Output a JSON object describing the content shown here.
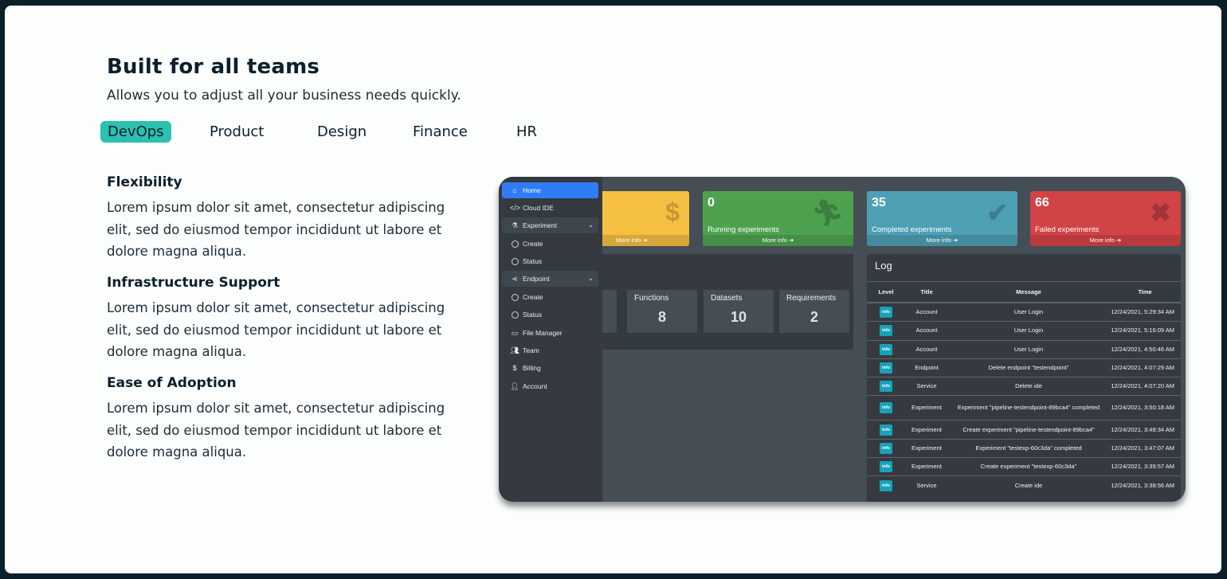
{
  "heading": {
    "title": "Built for all teams",
    "subtitle": "Allows you to adjust all your business needs quickly."
  },
  "tabs": [
    {
      "label": "DevOps",
      "active": true
    },
    {
      "label": "Product",
      "active": false
    },
    {
      "label": "Design",
      "active": false
    },
    {
      "label": "Finance",
      "active": false
    },
    {
      "label": "HR",
      "active": false
    }
  ],
  "features": [
    {
      "title": "Flexibility",
      "body": "Lorem ipsum dolor sit amet, consectetur adipiscing elit, sed do eiusmod tempor incididunt ut labore et dolore magna aliqua."
    },
    {
      "title": "Infrastructure Support",
      "body": "Lorem ipsum dolor sit amet, consectetur adipiscing elit, sed do eiusmod tempor incididunt ut labore et dolore magna aliqua."
    },
    {
      "title": "Ease of Adoption",
      "body": "Lorem ipsum dolor sit amet, consectetur adipiscing elit, sed do eiusmod tempor incididunt ut labore et dolore magna aliqua."
    }
  ],
  "dashboard": {
    "sidebar": [
      {
        "label": "Home",
        "icon": "home-icon",
        "active": true
      },
      {
        "label": "Cloud IDE",
        "icon": "code-icon"
      },
      {
        "label": "Experiment",
        "icon": "flask-icon",
        "group": true
      },
      {
        "label": "Create",
        "icon": "circle-icon"
      },
      {
        "label": "Status",
        "icon": "circle-icon"
      },
      {
        "label": "Endpoint",
        "icon": "share-icon",
        "group": true
      },
      {
        "label": "Create",
        "icon": "circle-icon"
      },
      {
        "label": "Status",
        "icon": "circle-icon"
      },
      {
        "label": "File Manager",
        "icon": "drive-icon"
      },
      {
        "label": "Team",
        "icon": "users-icon"
      },
      {
        "label": "Billing",
        "icon": "dollar-icon"
      },
      {
        "label": "Account",
        "icon": "user-icon"
      }
    ],
    "cards": [
      {
        "value": "",
        "label": "",
        "footer": "More info",
        "color": "#f5bf42",
        "icon": "$"
      },
      {
        "value": "0",
        "label": "Running experiments",
        "footer": "More info",
        "color": "#4ea24f",
        "icon": "running-icon"
      },
      {
        "value": "35",
        "label": "Completed experiments",
        "footer": "More info",
        "color": "#4da0b4",
        "icon": "check-icon"
      },
      {
        "value": "66",
        "label": "Failed experiments",
        "footer": "More info",
        "color": "#d24346",
        "icon": "times-icon"
      }
    ],
    "stats": [
      {
        "label": "Functions",
        "value": "8"
      },
      {
        "label": "Datasets",
        "value": "10"
      },
      {
        "label": "Requirements",
        "value": "2"
      }
    ],
    "log": {
      "title": "Log",
      "columns": [
        "Level",
        "Title",
        "Message",
        "Time"
      ],
      "rows": [
        {
          "level": "info",
          "title": "Account",
          "message": "User Login",
          "time": "12/24/2021, 5:29:34 AM"
        },
        {
          "level": "info",
          "title": "Account",
          "message": "User Login",
          "time": "12/24/2021, 5:16:09 AM"
        },
        {
          "level": "info",
          "title": "Account",
          "message": "User Login",
          "time": "12/24/2021, 4:50:46 AM"
        },
        {
          "level": "info",
          "title": "Endpoint",
          "message": "Delete endpoint \"testendpoint\"",
          "time": "12/24/2021, 4:07:29 AM"
        },
        {
          "level": "info",
          "title": "Service",
          "message": "Delete ide",
          "time": "12/24/2021, 4:07:20 AM"
        },
        {
          "level": "info",
          "title": "Experiment",
          "message": "Experiment \"pipeline-testendpoint-89bca4\" completed",
          "time": "12/24/2021, 3:50:18 AM"
        },
        {
          "level": "info",
          "title": "Experiment",
          "message": "Create experiment \"pipeline-testendpoint-89bca4\"",
          "time": "12/24/2021, 3:48:34 AM"
        },
        {
          "level": "info",
          "title": "Experiment",
          "message": "Experiment \"testexp-60c3da\" completed",
          "time": "12/24/2021, 3:47:07 AM"
        },
        {
          "level": "info",
          "title": "Experiment",
          "message": "Create experiment \"testexp-60c3da\"",
          "time": "12/24/2021, 3:39:57 AM"
        },
        {
          "level": "info",
          "title": "Service",
          "message": "Create ide",
          "time": "12/24/2021, 3:38:56 AM"
        }
      ]
    }
  }
}
